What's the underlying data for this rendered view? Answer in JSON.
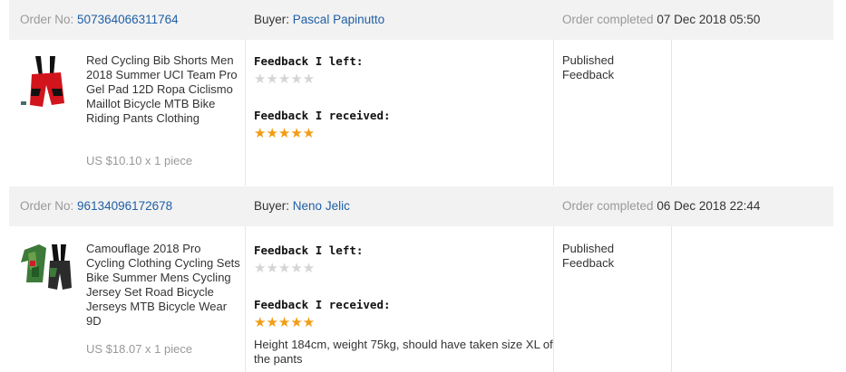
{
  "orders": [
    {
      "order_no_label": "Order No:",
      "order_no": "507364066311764",
      "buyer_label": "Buyer:",
      "buyer": "Pascal Papinutto",
      "completed_label": "Order completed",
      "completed_date": "07 Dec 2018 05:50",
      "product_title": "Red Cycling Bib Shorts Men 2018 Summer UCI Team Pro Gel Pad 12D Ropa Ciclismo Maillot Bicycle MTB Bike Riding Pants Clothing",
      "price": "US $10.10 x 1 piece",
      "feedback_left_label": "Feedback I left:",
      "feedback_left_stars": 0,
      "feedback_received_label": "Feedback I received:",
      "feedback_received_stars": 5,
      "comment": "",
      "status_line1": "Published",
      "status_line2": "Feedback",
      "thumb_colors": {
        "main": "#d2141c",
        "accent": "#111111"
      }
    },
    {
      "order_no_label": "Order No:",
      "order_no": "96134096172678",
      "buyer_label": "Buyer:",
      "buyer": "Neno Jelic",
      "completed_label": "Order completed",
      "completed_date": "06 Dec 2018 22:44",
      "product_title": "Camouflage 2018 Pro Cycling Clothing Cycling Sets Bike Summer Mens Cycling Jersey Set Road Bicycle Jerseys MTB Bicycle Wear 9D",
      "price": "US $18.07 x 1 piece",
      "feedback_left_label": "Feedback I left:",
      "feedback_left_stars": 0,
      "feedback_received_label": "Feedback I received:",
      "feedback_received_stars": 5,
      "comment": "Height 184cm, weight 75kg, should have taken size XL of the pants",
      "status_line1": "Published",
      "status_line2": "Feedback",
      "thumb_colors": {
        "main": "#3d7a3a",
        "accent": "#111111"
      }
    }
  ],
  "colors": {
    "header_bg": "#f2f2f2",
    "link": "#1f5fa6",
    "star_full": "#f39c12",
    "star_empty": "#d5d5d5"
  }
}
